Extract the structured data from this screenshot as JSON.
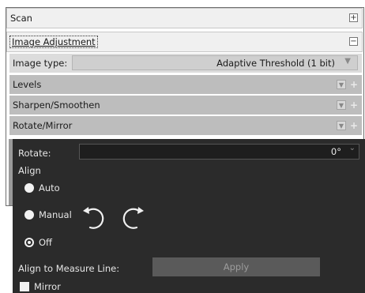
{
  "sections": {
    "scan": {
      "label": "Scan",
      "toggle": "+"
    },
    "image_adjustment": {
      "label": "Image Adjustment",
      "toggle": "−"
    }
  },
  "image_type": {
    "label": "Image type:",
    "value": "Adaptive Threshold (1 bit)"
  },
  "bars": {
    "levels": {
      "label": "Levels"
    },
    "sharpen": {
      "label": "Sharpen/Smoothen"
    },
    "rotate_mirror": {
      "label": "Rotate/Mirror"
    }
  },
  "rotate_panel": {
    "rotate_label": "Rotate:",
    "rotate_value": "0°",
    "align_label": "Align",
    "options": {
      "auto": "Auto",
      "manual": "Manual",
      "off": "Off"
    },
    "selected": "off",
    "measure_label": "Align to Measure Line:",
    "apply_label": "Apply",
    "mirror_label": "Mirror",
    "mirror_checked": false
  },
  "icons": {
    "rotate_left": "rotate-ccw-icon",
    "rotate_right": "rotate-cw-icon",
    "dropdown": "chevron-down-icon",
    "expand": "plus-icon"
  },
  "colors": {
    "panel_bg": "#2b2b2b",
    "bar_bg": "#bdbdbd",
    "apply_bg": "#5a5a5a"
  }
}
